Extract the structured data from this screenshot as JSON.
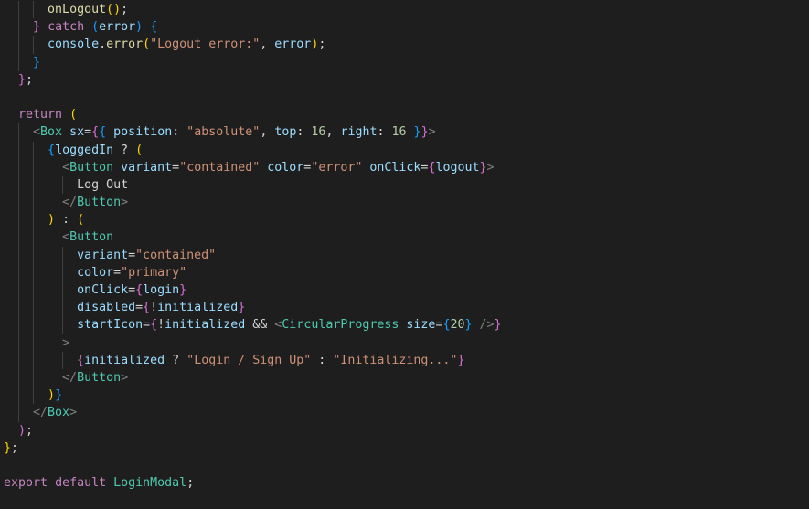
{
  "editor": {
    "language": "javascriptreact",
    "theme": "Dark+ (default dark)",
    "background_color": "#1e1e1e",
    "foreground_color": "#d4d4d4",
    "indent_guide_color": "#404040",
    "font_size_px": 13.3,
    "line_height_px": 19.2,
    "token_colors": {
      "keyword": "#c586c0",
      "variable": "#9cdcfe",
      "function": "#dcdcaa",
      "string": "#ce9178",
      "number": "#b5cea8",
      "component_tag": "#4ec9b0",
      "punctuation": "#808080",
      "plain": "#d4d4d4",
      "bracket_level_1": "#ffd700",
      "bracket_level_2": "#da70d6",
      "bracket_level_3": "#179fff"
    }
  },
  "code": {
    "lines": [
      {
        "indent_guides": [
          1,
          2
        ],
        "tokens": [
          {
            "t": "      ",
            "c": "plain"
          },
          {
            "t": "onLogout",
            "c": "fn"
          },
          {
            "t": "(",
            "c": "b1"
          },
          {
            "t": ")",
            "c": "b1"
          },
          {
            "t": ";",
            "c": "plain"
          }
        ]
      },
      {
        "indent_guides": [
          1
        ],
        "tokens": [
          {
            "t": "    ",
            "c": "plain"
          },
          {
            "t": "}",
            "c": "b2"
          },
          {
            "t": " ",
            "c": "plain"
          },
          {
            "t": "catch",
            "c": "kw"
          },
          {
            "t": " ",
            "c": "plain"
          },
          {
            "t": "(",
            "c": "b3"
          },
          {
            "t": "error",
            "c": "var"
          },
          {
            "t": ")",
            "c": "b3"
          },
          {
            "t": " ",
            "c": "plain"
          },
          {
            "t": "{",
            "c": "b3"
          }
        ]
      },
      {
        "indent_guides": [
          1,
          2
        ],
        "tokens": [
          {
            "t": "      ",
            "c": "plain"
          },
          {
            "t": "console",
            "c": "var"
          },
          {
            "t": ".",
            "c": "plain"
          },
          {
            "t": "error",
            "c": "fn"
          },
          {
            "t": "(",
            "c": "b1"
          },
          {
            "t": "\"Logout error:\"",
            "c": "str"
          },
          {
            "t": ",",
            "c": "plain"
          },
          {
            "t": " ",
            "c": "plain"
          },
          {
            "t": "error",
            "c": "var"
          },
          {
            "t": ")",
            "c": "b1"
          },
          {
            "t": ";",
            "c": "plain"
          }
        ]
      },
      {
        "indent_guides": [
          1
        ],
        "tokens": [
          {
            "t": "    ",
            "c": "plain"
          },
          {
            "t": "}",
            "c": "b3"
          }
        ]
      },
      {
        "indent_guides": [],
        "tokens": [
          {
            "t": "  ",
            "c": "plain"
          },
          {
            "t": "}",
            "c": "b2"
          },
          {
            "t": ";",
            "c": "plain"
          }
        ]
      },
      {
        "indent_guides": [],
        "tokens": []
      },
      {
        "indent_guides": [],
        "tokens": [
          {
            "t": "  ",
            "c": "plain"
          },
          {
            "t": "return",
            "c": "kw"
          },
          {
            "t": " ",
            "c": "plain"
          },
          {
            "t": "(",
            "c": "b1"
          }
        ]
      },
      {
        "indent_guides": [
          1
        ],
        "tokens": [
          {
            "t": "    ",
            "c": "plain"
          },
          {
            "t": "<",
            "c": "punct"
          },
          {
            "t": "Box",
            "c": "tag"
          },
          {
            "t": " ",
            "c": "plain"
          },
          {
            "t": "sx",
            "c": "var"
          },
          {
            "t": "=",
            "c": "plain"
          },
          {
            "t": "{",
            "c": "b2"
          },
          {
            "t": "{",
            "c": "b3"
          },
          {
            "t": " ",
            "c": "plain"
          },
          {
            "t": "position",
            "c": "var"
          },
          {
            "t": ":",
            "c": "plain"
          },
          {
            "t": " ",
            "c": "plain"
          },
          {
            "t": "\"absolute\"",
            "c": "str"
          },
          {
            "t": ",",
            "c": "plain"
          },
          {
            "t": " ",
            "c": "plain"
          },
          {
            "t": "top",
            "c": "var"
          },
          {
            "t": ":",
            "c": "plain"
          },
          {
            "t": " ",
            "c": "plain"
          },
          {
            "t": "16",
            "c": "num"
          },
          {
            "t": ",",
            "c": "plain"
          },
          {
            "t": " ",
            "c": "plain"
          },
          {
            "t": "right",
            "c": "var"
          },
          {
            "t": ":",
            "c": "plain"
          },
          {
            "t": " ",
            "c": "plain"
          },
          {
            "t": "16",
            "c": "num"
          },
          {
            "t": " ",
            "c": "plain"
          },
          {
            "t": "}",
            "c": "b3"
          },
          {
            "t": "}",
            "c": "b2"
          },
          {
            "t": ">",
            "c": "punct"
          }
        ]
      },
      {
        "indent_guides": [
          1,
          2
        ],
        "tokens": [
          {
            "t": "      ",
            "c": "plain"
          },
          {
            "t": "{",
            "c": "b3"
          },
          {
            "t": "loggedIn",
            "c": "var"
          },
          {
            "t": " ",
            "c": "plain"
          },
          {
            "t": "?",
            "c": "plain"
          },
          {
            "t": " ",
            "c": "plain"
          },
          {
            "t": "(",
            "c": "b1"
          }
        ]
      },
      {
        "indent_guides": [
          1,
          2,
          3
        ],
        "tokens": [
          {
            "t": "        ",
            "c": "plain"
          },
          {
            "t": "<",
            "c": "punct"
          },
          {
            "t": "Button",
            "c": "tag"
          },
          {
            "t": " ",
            "c": "plain"
          },
          {
            "t": "variant",
            "c": "var"
          },
          {
            "t": "=",
            "c": "plain"
          },
          {
            "t": "\"contained\"",
            "c": "str"
          },
          {
            "t": " ",
            "c": "plain"
          },
          {
            "t": "color",
            "c": "var"
          },
          {
            "t": "=",
            "c": "plain"
          },
          {
            "t": "\"error\"",
            "c": "str"
          },
          {
            "t": " ",
            "c": "plain"
          },
          {
            "t": "onClick",
            "c": "var"
          },
          {
            "t": "=",
            "c": "plain"
          },
          {
            "t": "{",
            "c": "b2"
          },
          {
            "t": "logout",
            "c": "var"
          },
          {
            "t": "}",
            "c": "b2"
          },
          {
            "t": ">",
            "c": "punct"
          }
        ]
      },
      {
        "indent_guides": [
          1,
          2,
          3,
          4
        ],
        "tokens": [
          {
            "t": "          ",
            "c": "plain"
          },
          {
            "t": "Log Out",
            "c": "plain"
          }
        ]
      },
      {
        "indent_guides": [
          1,
          2,
          3
        ],
        "tokens": [
          {
            "t": "        ",
            "c": "plain"
          },
          {
            "t": "</",
            "c": "punct"
          },
          {
            "t": "Button",
            "c": "tag"
          },
          {
            "t": ">",
            "c": "punct"
          }
        ]
      },
      {
        "indent_guides": [
          1,
          2
        ],
        "tokens": [
          {
            "t": "      ",
            "c": "plain"
          },
          {
            "t": ")",
            "c": "b1"
          },
          {
            "t": " ",
            "c": "plain"
          },
          {
            "t": ":",
            "c": "plain"
          },
          {
            "t": " ",
            "c": "plain"
          },
          {
            "t": "(",
            "c": "b1"
          }
        ]
      },
      {
        "indent_guides": [
          1,
          2,
          3
        ],
        "tokens": [
          {
            "t": "        ",
            "c": "plain"
          },
          {
            "t": "<",
            "c": "punct"
          },
          {
            "t": "Button",
            "c": "tag"
          }
        ]
      },
      {
        "indent_guides": [
          1,
          2,
          3,
          4
        ],
        "tokens": [
          {
            "t": "          ",
            "c": "plain"
          },
          {
            "t": "variant",
            "c": "var"
          },
          {
            "t": "=",
            "c": "plain"
          },
          {
            "t": "\"contained\"",
            "c": "str"
          }
        ]
      },
      {
        "indent_guides": [
          1,
          2,
          3,
          4
        ],
        "tokens": [
          {
            "t": "          ",
            "c": "plain"
          },
          {
            "t": "color",
            "c": "var"
          },
          {
            "t": "=",
            "c": "plain"
          },
          {
            "t": "\"primary\"",
            "c": "str"
          }
        ]
      },
      {
        "indent_guides": [
          1,
          2,
          3,
          4
        ],
        "tokens": [
          {
            "t": "          ",
            "c": "plain"
          },
          {
            "t": "onClick",
            "c": "var"
          },
          {
            "t": "=",
            "c": "plain"
          },
          {
            "t": "{",
            "c": "b2"
          },
          {
            "t": "login",
            "c": "var"
          },
          {
            "t": "}",
            "c": "b2"
          }
        ]
      },
      {
        "indent_guides": [
          1,
          2,
          3,
          4
        ],
        "tokens": [
          {
            "t": "          ",
            "c": "plain"
          },
          {
            "t": "disabled",
            "c": "var"
          },
          {
            "t": "=",
            "c": "plain"
          },
          {
            "t": "{",
            "c": "b2"
          },
          {
            "t": "!",
            "c": "plain"
          },
          {
            "t": "initialized",
            "c": "var"
          },
          {
            "t": "}",
            "c": "b2"
          }
        ]
      },
      {
        "indent_guides": [
          1,
          2,
          3,
          4
        ],
        "tokens": [
          {
            "t": "          ",
            "c": "plain"
          },
          {
            "t": "startIcon",
            "c": "var"
          },
          {
            "t": "=",
            "c": "plain"
          },
          {
            "t": "{",
            "c": "b2"
          },
          {
            "t": "!",
            "c": "plain"
          },
          {
            "t": "initialized",
            "c": "var"
          },
          {
            "t": " ",
            "c": "plain"
          },
          {
            "t": "&&",
            "c": "plain"
          },
          {
            "t": " ",
            "c": "plain"
          },
          {
            "t": "<",
            "c": "punct"
          },
          {
            "t": "CircularProgress",
            "c": "tag"
          },
          {
            "t": " ",
            "c": "plain"
          },
          {
            "t": "size",
            "c": "var"
          },
          {
            "t": "=",
            "c": "plain"
          },
          {
            "t": "{",
            "c": "b3"
          },
          {
            "t": "20",
            "c": "num"
          },
          {
            "t": "}",
            "c": "b3"
          },
          {
            "t": " ",
            "c": "plain"
          },
          {
            "t": "/>",
            "c": "punct"
          },
          {
            "t": "}",
            "c": "b2"
          }
        ]
      },
      {
        "indent_guides": [
          1,
          2,
          3
        ],
        "tokens": [
          {
            "t": "        ",
            "c": "plain"
          },
          {
            "t": ">",
            "c": "punct"
          }
        ]
      },
      {
        "indent_guides": [
          1,
          2,
          3,
          4
        ],
        "tokens": [
          {
            "t": "          ",
            "c": "plain"
          },
          {
            "t": "{",
            "c": "b2"
          },
          {
            "t": "initialized",
            "c": "var"
          },
          {
            "t": " ",
            "c": "plain"
          },
          {
            "t": "?",
            "c": "plain"
          },
          {
            "t": " ",
            "c": "plain"
          },
          {
            "t": "\"Login / Sign Up\"",
            "c": "str"
          },
          {
            "t": " ",
            "c": "plain"
          },
          {
            "t": ":",
            "c": "plain"
          },
          {
            "t": " ",
            "c": "plain"
          },
          {
            "t": "\"Initializing...\"",
            "c": "str"
          },
          {
            "t": "}",
            "c": "b2"
          }
        ]
      },
      {
        "indent_guides": [
          1,
          2,
          3
        ],
        "tokens": [
          {
            "t": "        ",
            "c": "plain"
          },
          {
            "t": "</",
            "c": "punct"
          },
          {
            "t": "Button",
            "c": "tag"
          },
          {
            "t": ">",
            "c": "punct"
          }
        ]
      },
      {
        "indent_guides": [
          1,
          2
        ],
        "tokens": [
          {
            "t": "      ",
            "c": "plain"
          },
          {
            "t": ")",
            "c": "b1"
          },
          {
            "t": "}",
            "c": "b3"
          }
        ]
      },
      {
        "indent_guides": [
          1
        ],
        "tokens": [
          {
            "t": "    ",
            "c": "plain"
          },
          {
            "t": "</",
            "c": "punct"
          },
          {
            "t": "Box",
            "c": "tag"
          },
          {
            "t": ">",
            "c": "punct"
          }
        ]
      },
      {
        "indent_guides": [],
        "tokens": [
          {
            "t": "  ",
            "c": "plain"
          },
          {
            "t": ")",
            "c": "b2"
          },
          {
            "t": ";",
            "c": "plain"
          }
        ]
      },
      {
        "indent_guides": [],
        "tokens": [
          {
            "t": "}",
            "c": "b1"
          },
          {
            "t": ";",
            "c": "plain"
          }
        ]
      },
      {
        "indent_guides": [],
        "tokens": []
      },
      {
        "indent_guides": [],
        "tokens": [
          {
            "t": "export",
            "c": "kw"
          },
          {
            "t": " ",
            "c": "plain"
          },
          {
            "t": "default",
            "c": "kw"
          },
          {
            "t": " ",
            "c": "plain"
          },
          {
            "t": "LoginModal",
            "c": "type"
          },
          {
            "t": ";",
            "c": "plain"
          }
        ]
      }
    ]
  }
}
